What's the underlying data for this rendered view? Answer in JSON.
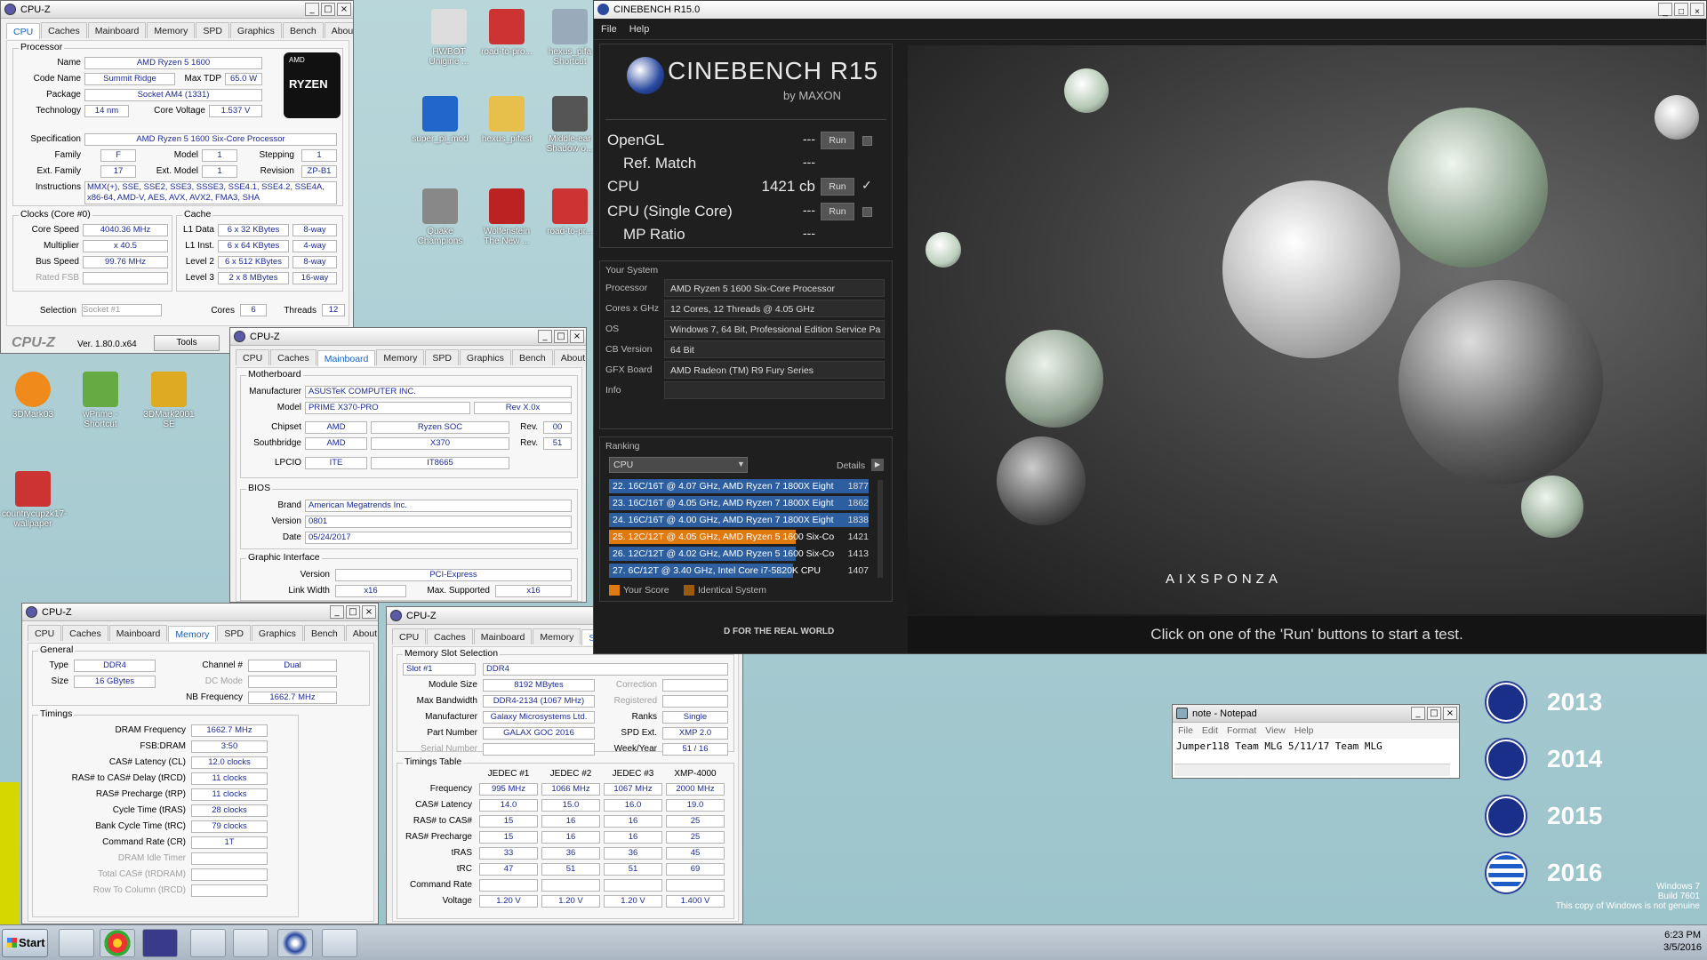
{
  "cpuz_cpu": {
    "title": "CPU-Z",
    "tabs": [
      "CPU",
      "Caches",
      "Mainboard",
      "Memory",
      "SPD",
      "Graphics",
      "Bench",
      "About"
    ],
    "processor": "Processor",
    "name_l": "Name",
    "name": "AMD Ryzen 5 1600",
    "code_l": "Code Name",
    "code": "Summit Ridge",
    "tdp_l": "Max TDP",
    "tdp": "65.0 W",
    "pkg_l": "Package",
    "pkg": "Socket AM4 (1331)",
    "tech_l": "Technology",
    "tech": "14 nm",
    "cv_l": "Core Voltage",
    "cv": "1.537 V",
    "spec_l": "Specification",
    "spec": "AMD Ryzen 5 1600 Six-Core Processor",
    "fam_l": "Family",
    "fam": "F",
    "model_l": "Model",
    "model": "1",
    "step_l": "Stepping",
    "step": "1",
    "efam_l": "Ext. Family",
    "efam": "17",
    "emodel_l": "Ext. Model",
    "emodel": "1",
    "rev_l": "Revision",
    "rev": "ZP-B1",
    "inst_l": "Instructions",
    "inst": "MMX(+), SSE, SSE2, SSE3, SSSE3, SSE4.1, SSE4.2, SSE4A, x86-64, AMD-V, AES, AVX, AVX2, FMA3, SHA",
    "clocks": "Clocks (Core #0)",
    "cs_l": "Core Speed",
    "cs": "4040.36 MHz",
    "mul_l": "Multiplier",
    "mul": "x 40.5",
    "bus_l": "Bus Speed",
    "bus": "99.76 MHz",
    "fsb_l": "Rated FSB",
    "cache": "Cache",
    "l1d_l": "L1 Data",
    "l1d": "6 x 32 KBytes",
    "l1d_w": "8-way",
    "l1i_l": "L1 Inst.",
    "l1i": "6 x 64 KBytes",
    "l1i_w": "4-way",
    "l2_l": "Level 2",
    "l2": "6 x 512 KBytes",
    "l2_w": "8-way",
    "l3_l": "Level 3",
    "l3": "2 x 8 MBytes",
    "l3_w": "16-way",
    "sel_l": "Selection",
    "sel": "Socket #1",
    "cores_l": "Cores",
    "cores": "6",
    "thr_l": "Threads",
    "thr": "12",
    "ver": "Ver. 1.80.0.x64",
    "tools": "Tools",
    "logo": "CPU-Z",
    "ryzen": "RYZEN",
    "amd": "AMD"
  },
  "cpuz_mb": {
    "title": "CPU-Z",
    "mb": "Motherboard",
    "man_l": "Manufacturer",
    "man": "ASUSTeK COMPUTER INC.",
    "model_l": "Model",
    "model": "PRIME X370-PRO",
    "rev": "Rev X.0x",
    "chip_l": "Chipset",
    "chip": "AMD",
    "chip2": "Ryzen SOC",
    "chiprev_l": "Rev.",
    "chiprev": "00",
    "sb_l": "Southbridge",
    "sb": "AMD",
    "sb2": "X370",
    "sbrev": "51",
    "lpc_l": "LPCIO",
    "lpc": "ITE",
    "lpc2": "IT8665",
    "bios": "BIOS",
    "brand_l": "Brand",
    "brand": "American Megatrends Inc.",
    "ver_l": "Version",
    "ver": "0801",
    "date_l": "Date",
    "date": "05/24/2017",
    "gi": "Graphic Interface",
    "giv_l": "Version",
    "giv": "PCI-Express",
    "lw_l": "Link Width",
    "lw": "x16",
    "ms_l": "Max. Supported",
    "ms": "x16"
  },
  "cpuz_mem": {
    "title": "CPU-Z",
    "general": "General",
    "type_l": "Type",
    "type": "DDR4",
    "ch_l": "Channel #",
    "ch": "Dual",
    "size_l": "Size",
    "size": "16 GBytes",
    "dc_l": "DC Mode",
    "nb_l": "NB Frequency",
    "nb": "1662.7 MHz",
    "timings": "Timings",
    "rows": [
      {
        "l": "DRAM Frequency",
        "v": "1662.7 MHz"
      },
      {
        "l": "FSB:DRAM",
        "v": "3:50"
      },
      {
        "l": "CAS# Latency (CL)",
        "v": "12.0 clocks"
      },
      {
        "l": "RAS# to CAS# Delay (tRCD)",
        "v": "11 clocks"
      },
      {
        "l": "RAS# Precharge (tRP)",
        "v": "11 clocks"
      },
      {
        "l": "Cycle Time (tRAS)",
        "v": "28 clocks"
      },
      {
        "l": "Bank Cycle Time (tRC)",
        "v": "79 clocks"
      },
      {
        "l": "Command Rate (CR)",
        "v": "1T"
      },
      {
        "l": "DRAM Idle Timer",
        "v": ""
      },
      {
        "l": "Total CAS# (tRDRAM)",
        "v": ""
      },
      {
        "l": "Row To Column (tRCD)",
        "v": ""
      }
    ]
  },
  "cpuz_spd": {
    "title": "CPU-Z",
    "sel": "Memory Slot Selection",
    "slot": "Slot #1",
    "ddr": "DDR4",
    "msz_l": "Module Size",
    "msz": "8192 MBytes",
    "corr_l": "Correction",
    "mbw_l": "Max Bandwidth",
    "mbw": "DDR4-2134 (1067 MHz)",
    "reg_l": "Registered",
    "man_l": "Manufacturer",
    "man": "Galaxy Microsystems Ltd.",
    "ranks_l": "Ranks",
    "ranks": "Single",
    "pn_l": "Part Number",
    "pn": "GALAX GOC 2016",
    "spdx_l": "SPD Ext.",
    "spdx": "XMP 2.0",
    "sn_l": "Serial Number",
    "wy_l": "Week/Year",
    "wy": "51 / 16",
    "tt": "Timings Table",
    "cols": [
      "JEDEC #1",
      "JEDEC #2",
      "JEDEC #3",
      "XMP-4000"
    ],
    "trows": [
      {
        "l": "Frequency",
        "v": [
          "995 MHz",
          "1066 MHz",
          "1067 MHz",
          "2000 MHz"
        ]
      },
      {
        "l": "CAS# Latency",
        "v": [
          "14.0",
          "15.0",
          "16.0",
          "19.0"
        ]
      },
      {
        "l": "RAS# to CAS#",
        "v": [
          "15",
          "16",
          "16",
          "25"
        ]
      },
      {
        "l": "RAS# Precharge",
        "v": [
          "15",
          "16",
          "16",
          "25"
        ]
      },
      {
        "l": "tRAS",
        "v": [
          "33",
          "36",
          "36",
          "45"
        ]
      },
      {
        "l": "tRC",
        "v": [
          "47",
          "51",
          "51",
          "69"
        ]
      },
      {
        "l": "Command Rate",
        "v": [
          "",
          "",
          "",
          ""
        ]
      },
      {
        "l": "Voltage",
        "v": [
          "1.20 V",
          "1.20 V",
          "1.20 V",
          "1.400 V"
        ]
      }
    ]
  },
  "cb": {
    "title": "CINEBENCH R15.0",
    "menu": [
      "File",
      "Help"
    ],
    "logo": "CINEBENCH R15",
    "by": "by MAXON",
    "ogl": "OpenGL",
    "ogl_v": "---",
    "ref": "Ref. Match",
    "ref_v": "---",
    "cpu": "CPU",
    "cpu_v": "1421 cb",
    "sc": "CPU (Single Core)",
    "sc_v": "---",
    "mp": "MP Ratio",
    "mp_v": "---",
    "run": "Run",
    "ys": "Your System",
    "sys": [
      {
        "l": "Processor",
        "v": "AMD Ryzen 5 1600 Six-Core Processor"
      },
      {
        "l": "Cores x GHz",
        "v": "12 Cores, 12 Threads @ 4.05 GHz"
      },
      {
        "l": "OS",
        "v": "Windows 7, 64 Bit, Professional Edition Service Pa"
      },
      {
        "l": "CB Version",
        "v": "64 Bit"
      },
      {
        "l": "GFX Board",
        "v": "AMD Radeon (TM) R9 Fury Series"
      },
      {
        "l": "Info",
        "v": ""
      }
    ],
    "ranking": "Ranking",
    "rsel": "CPU",
    "details": "Details",
    "rank": [
      {
        "t": "22. 16C/16T @ 4.07 GHz, AMD Ryzen 7 1800X Eight",
        "s": "1877",
        "c": "#2d5fa0",
        "w": 1
      },
      {
        "t": "23. 16C/16T @ 4.05 GHz, AMD Ryzen 7 1800X Eight",
        "s": "1862",
        "c": "#2d5fa0",
        "w": 1
      },
      {
        "t": "24. 16C/16T @ 4.00 GHz, AMD Ryzen 7 1800X Eight",
        "s": "1838",
        "c": "#2d5fa0",
        "w": 1
      },
      {
        "t": "25. 12C/12T @ 4.05 GHz, AMD Ryzen 5 1600 Six-Co",
        "s": "1421",
        "c": "#e07a10",
        "w": 0.72
      },
      {
        "t": "26. 12C/12T @ 4.02 GHz, AMD Ryzen 5 1600 Six-Co",
        "s": "1413",
        "c": "#2d5fa0",
        "w": 0.72
      },
      {
        "t": "27. 6C/12T @ 3.40 GHz, Intel Core i7-5820K CPU",
        "s": "1407",
        "c": "#2d5fa0",
        "w": 0.71
      }
    ],
    "yours": "Your Score",
    "ident": "Identical System",
    "msg": "Click on one of the 'Run' buttons to start a test.",
    "aix": "AIXSPONZA",
    "realworld": "D FOR THE REAL WORLD"
  },
  "notepad": {
    "title": "note - Notepad",
    "menu": [
      "File",
      "Edit",
      "Format",
      "View",
      "Help"
    ],
    "text": "Jumper118 Team MLG 5/11/17 Team MLG"
  },
  "desktop": {
    "icons": [
      {
        "t": "HWBOT Unigine ..."
      },
      {
        "t": "road-to-pro..."
      },
      {
        "t": "hexus_pifa Shortcut"
      },
      {
        "t": "super_pi_mod"
      },
      {
        "t": "hexus_pifast"
      },
      {
        "t": "Middle-ear Shadow o..."
      },
      {
        "t": "Quake Champions"
      },
      {
        "t": "Wolfenstein The New ..."
      },
      {
        "t": "road-to-pr..."
      },
      {
        "t": "3DMark03"
      },
      {
        "t": "wPrime - Shortcut"
      },
      {
        "t": "3DMark2001 SE"
      },
      {
        "t": "countrycupzk17-wallpaper"
      }
    ],
    "years": [
      "2013",
      "2014",
      "2015",
      "2016"
    ],
    "win": "Windows 7",
    "build": "Build 7601",
    "genuine": "This copy of Windows is not genuine"
  },
  "taskbar": {
    "start": "Start",
    "time": "6:23 PM",
    "date": "3/5/2016"
  }
}
